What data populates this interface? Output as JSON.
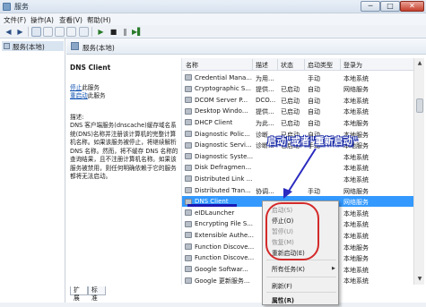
{
  "window": {
    "title": "服务",
    "min": "─",
    "max": "□",
    "close": "✕"
  },
  "menu": [
    "文件(F)",
    "操作(A)",
    "查看(V)",
    "帮助(H)"
  ],
  "toolbar": {
    "back": "◀",
    "forward": "▶",
    "play": "▶",
    "stop": "■",
    "pause": "‖",
    "restart": "▶▌"
  },
  "tree": {
    "root_label": "服务(本地)"
  },
  "main": {
    "header": "服务(本地)"
  },
  "detail": {
    "service_name": "DNS Client",
    "stop_link": "停止",
    "stop_suffix": "此服务",
    "restart_link": "重启动",
    "restart_suffix": "此服务",
    "desc_title": "描述:",
    "desc_text": "DNS 客户端服务(dnscache)缓存域名系统(DNS)名称并注册该计算机的完整计算机名称。如果该服务被停止，将继续解析 DNS 名称。然而，将不缓存 DNS 名称的查询结果，且不注册计算机名称。如果该服务被禁用，则任何明确依赖于它的服务都将无法启动。"
  },
  "list": {
    "columns": {
      "name": "名称",
      "desc": "描述",
      "status": "状态",
      "start": "启动类型",
      "logon": "登录为"
    },
    "rows": [
      {
        "name": "Credential Mana...",
        "desc": "为用...",
        "status": "",
        "start": "手动",
        "logon": "本地系统",
        "selected": false
      },
      {
        "name": "Cryptographic S...",
        "desc": "提供...",
        "status": "已启动",
        "start": "自动",
        "logon": "网络服务",
        "selected": false
      },
      {
        "name": "DCOM Server P...",
        "desc": "DCO...",
        "status": "已启动",
        "start": "自动",
        "logon": "本地系统",
        "selected": false
      },
      {
        "name": "Desktop Windo...",
        "desc": "提供...",
        "status": "已启动",
        "start": "自动",
        "logon": "本地系统",
        "selected": false
      },
      {
        "name": "DHCP Client",
        "desc": "为此...",
        "status": "已启动",
        "start": "自动",
        "logon": "本地服务",
        "selected": false
      },
      {
        "name": "Diagnostic Polic...",
        "desc": "诊断...",
        "status": "已启动",
        "start": "自动",
        "logon": "本地服务",
        "selected": false
      },
      {
        "name": "Diagnostic Servi...",
        "desc": "诊断...",
        "status": "已启动",
        "start": "手动",
        "logon": "本地服务",
        "selected": false
      },
      {
        "name": "Diagnostic Syste...",
        "desc": "",
        "status": "",
        "start": "",
        "logon": "本地系统",
        "selected": false
      },
      {
        "name": "Disk Defragmen...",
        "desc": "",
        "status": "",
        "start": "",
        "logon": "本地系统",
        "selected": false
      },
      {
        "name": "Distributed Link ...",
        "desc": "",
        "status": "",
        "start": "",
        "logon": "本地系统",
        "selected": false
      },
      {
        "name": "Distributed Tran...",
        "desc": "协调...",
        "status": "",
        "start": "手动",
        "logon": "网络服务",
        "selected": false
      },
      {
        "name": "DNS Client",
        "desc": "",
        "status": "",
        "start": "",
        "logon": "网络服务",
        "selected": true
      },
      {
        "name": "eIDLauncher",
        "desc": "",
        "status": "",
        "start": "",
        "logon": "本地系统",
        "selected": false
      },
      {
        "name": "Encrypting File S...",
        "desc": "",
        "status": "",
        "start": "",
        "logon": "本地系统",
        "selected": false
      },
      {
        "name": "Extensible Authe...",
        "desc": "",
        "status": "",
        "start": "",
        "logon": "本地系统",
        "selected": false
      },
      {
        "name": "Function Discove...",
        "desc": "",
        "status": "",
        "start": "",
        "logon": "本地服务",
        "selected": false
      },
      {
        "name": "Function Discove...",
        "desc": "",
        "status": "",
        "start": "",
        "logon": "本地服务",
        "selected": false
      },
      {
        "name": "Google Softwar...",
        "desc": "",
        "status": "",
        "start": "",
        "logon": "本地系统",
        "selected": false
      },
      {
        "name": "Google 更新服务...",
        "desc": "",
        "status": "",
        "start": "",
        "logon": "本地系统",
        "selected": false
      }
    ]
  },
  "scrollbar": {
    "up": "▲",
    "down": "▼"
  },
  "context_menu": {
    "items": [
      {
        "label": "启动(S)",
        "disabled": true
      },
      {
        "label": "停止(O)",
        "disabled": false
      },
      {
        "label": "暂停(U)",
        "disabled": true
      },
      {
        "label": "恢复(M)",
        "disabled": true
      },
      {
        "label": "重新启动(E)",
        "disabled": false
      },
      {
        "label": "所有任务(K)",
        "disabled": false
      },
      {
        "label": "刷新(F)",
        "disabled": false
      },
      {
        "label": "属性(R)",
        "disabled": false
      }
    ],
    "submenu_arrow": "▶"
  },
  "tabs": {
    "extended": "扩展",
    "standard": "标准"
  },
  "annotation": {
    "text": "启动\"或者\"重新启动\"",
    "ring_color": "#d42a2a",
    "arrow_color": "#2a2ac0"
  }
}
